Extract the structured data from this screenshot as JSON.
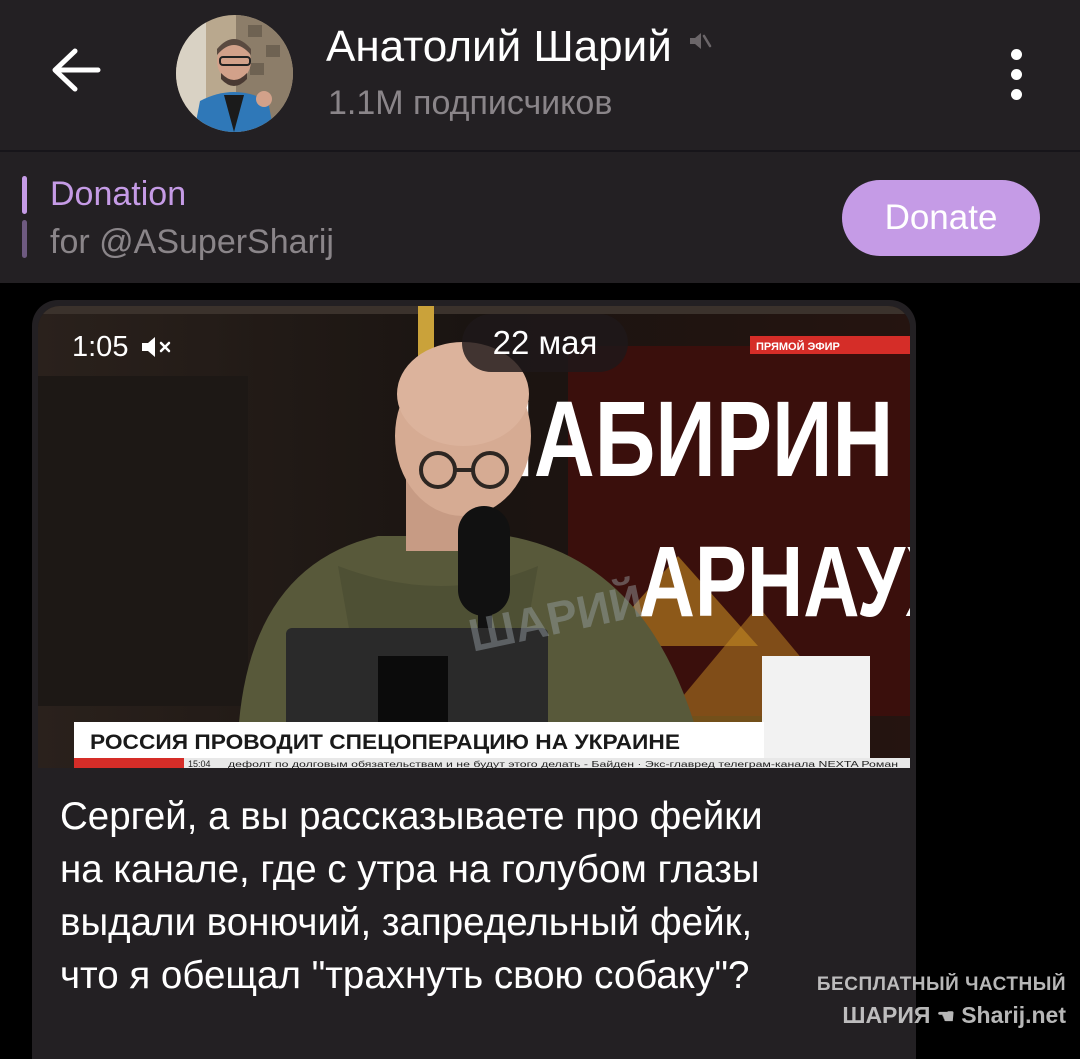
{
  "header": {
    "title": "Анатолий Шарий",
    "subscribers": "1.1M подписчиков"
  },
  "pinned": {
    "title": "Donation",
    "subtitle": "for @ASuperSharij",
    "button_label": "Donate"
  },
  "message": {
    "video": {
      "duration": "1:05",
      "date": "22 мая",
      "overlay_big_line1": "ЛАБИРИН",
      "overlay_big_line2": "АРНАУХО",
      "overlay_watermark": "ШАРИЙ",
      "overlay_live": "ПРЯМОЙ ЭФИР",
      "overlay_ticker": "РОССИЯ ПРОВОДИТ СПЕЦОПЕРАЦИЮ НА УКРАИНЕ",
      "overlay_clock": "15:04",
      "overlay_bottom_scroll": "дефолт по долговым обязательствам и не будут этого делать - Байден · Экс-главред телеграм-канала NEXTA Роман"
    },
    "text_lines": [
      "Сергей, а вы рассказываете про фейки",
      "на канале, где с утра на голубом глазы",
      "выдали вонючий, запредельный фейк,",
      "что я обещал \"трахнуть свою собаку\"?"
    ]
  },
  "watermark": {
    "line1": "БЕСПЛАТНЫЙ ЧАСТНЫЙ",
    "line2_left": "ШАРИЯ",
    "line2_right": "Sharij.net"
  },
  "colors": {
    "accent": "#c59be6",
    "panel": "#232023",
    "background": "#000000",
    "muted_text": "#8a8589"
  },
  "icons": {
    "back": "arrow-left-icon",
    "mute": "muted-speaker-icon",
    "menu": "more-vertical-icon",
    "video_mute": "volume-off-icon"
  }
}
